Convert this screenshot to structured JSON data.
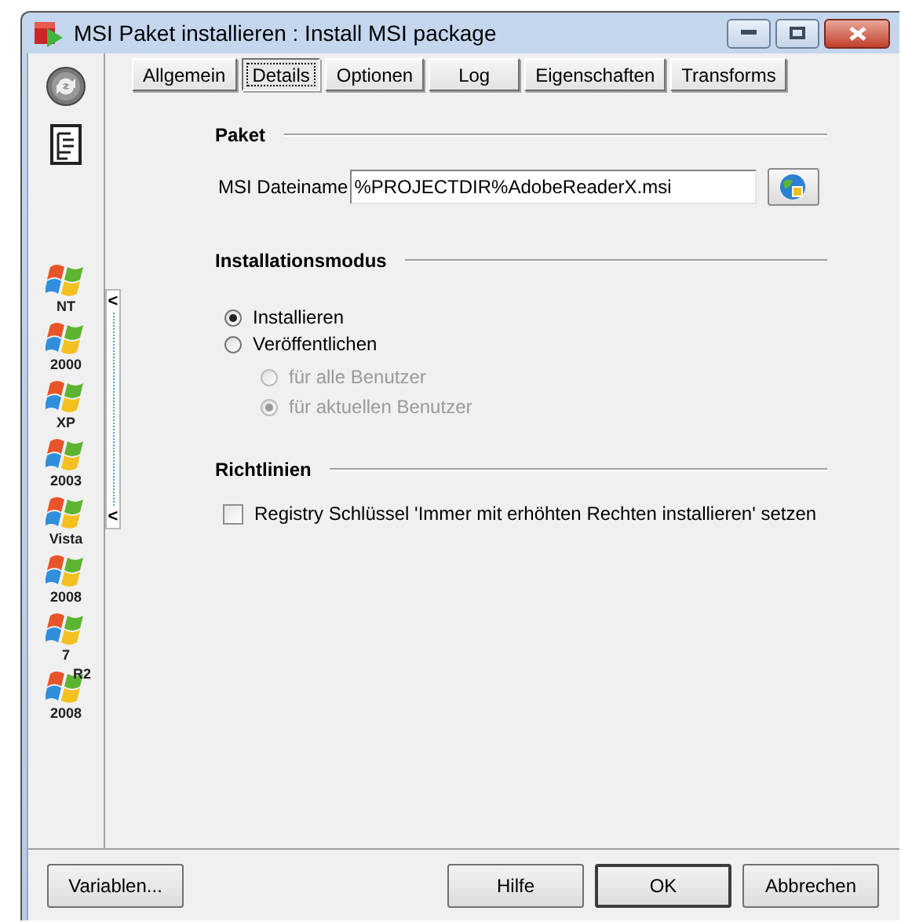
{
  "window": {
    "title": "MSI Paket installieren : Install MSI package"
  },
  "sidebar": {
    "items": [
      {
        "kind": "refresh"
      },
      {
        "kind": "script"
      },
      {
        "kind": "os",
        "label": "NT"
      },
      {
        "kind": "os",
        "label": "2000"
      },
      {
        "kind": "os",
        "label": "XP"
      },
      {
        "kind": "os",
        "label": "2003"
      },
      {
        "kind": "os",
        "label": "Vista"
      },
      {
        "kind": "os",
        "label": "2008"
      },
      {
        "kind": "os",
        "label": "7"
      },
      {
        "kind": "os",
        "label": "2008",
        "badge": "R2"
      }
    ]
  },
  "splitter": {
    "glyphs": [
      "<",
      "<"
    ]
  },
  "tabs": [
    {
      "label": "Allgemein",
      "selected": false
    },
    {
      "label": "Details",
      "selected": true
    },
    {
      "label": "Optionen",
      "selected": false
    },
    {
      "label": "Log",
      "selected": false
    },
    {
      "label": "Eigenschaften",
      "selected": false
    },
    {
      "label": "Transforms",
      "selected": false
    }
  ],
  "package": {
    "title": "Paket",
    "field_label": "MSI Dateiname",
    "value": "%PROJECTDIR%AdobeReaderX.msi"
  },
  "install_mode": {
    "title": "Installationsmodus",
    "options": [
      {
        "label": "Installieren",
        "selected": true,
        "disabled": false
      },
      {
        "label": "Veröffentlichen",
        "selected": false,
        "disabled": false,
        "children": [
          {
            "label": "für alle Benutzer",
            "selected": false,
            "disabled": true
          },
          {
            "label": "für aktuellen Benutzer",
            "selected": true,
            "disabled": true
          }
        ]
      }
    ]
  },
  "policies": {
    "title": "Richtlinien",
    "checkboxes": [
      {
        "label": "Registry Schlüssel 'Immer mit erhöhten Rechten installieren' setzen",
        "checked": false
      }
    ]
  },
  "buttons": [
    {
      "label": "Variablen...",
      "default": false
    },
    {
      "label": "Hilfe",
      "default": false
    },
    {
      "label": "OK",
      "default": true
    },
    {
      "label": "Abbrechen",
      "default": false
    }
  ]
}
